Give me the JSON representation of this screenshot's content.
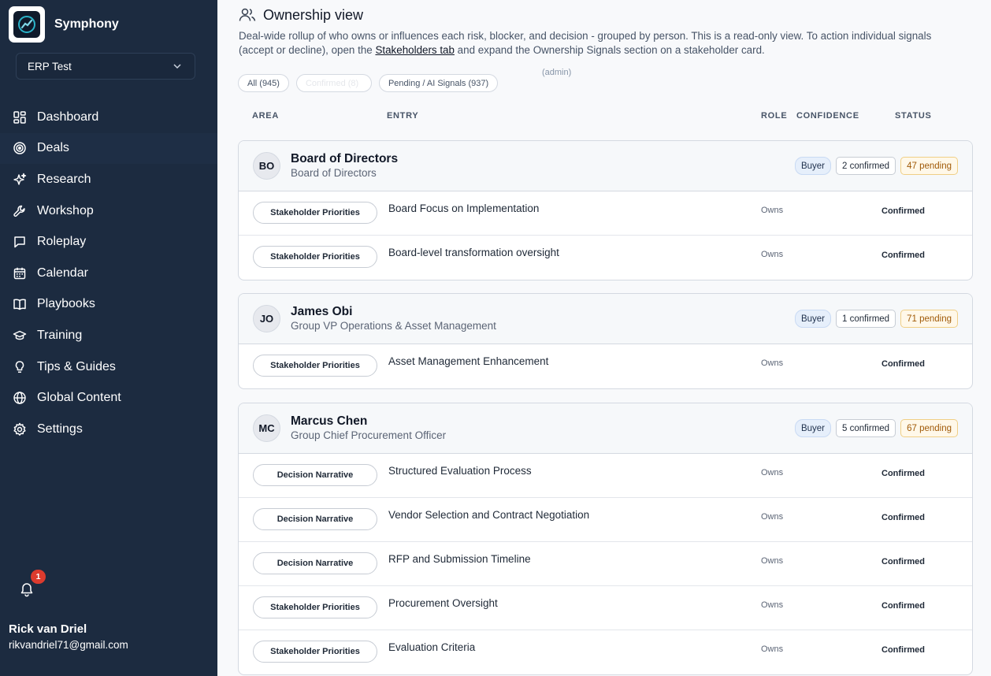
{
  "app": {
    "name": "Symphony"
  },
  "workspace": {
    "name": "ERP Test",
    "role": "(admin)"
  },
  "nav": [
    {
      "label": "Dashboard",
      "icon": "dashboard-icon"
    },
    {
      "label": "Deals",
      "icon": "target-icon"
    },
    {
      "label": "Research",
      "icon": "sparkles-icon"
    },
    {
      "label": "Workshop",
      "icon": "wrench-icon"
    },
    {
      "label": "Roleplay",
      "icon": "chat-icon"
    },
    {
      "label": "Calendar",
      "icon": "calendar-icon"
    },
    {
      "label": "Playbooks",
      "icon": "book-icon"
    },
    {
      "label": "Training",
      "icon": "graduation-cap-icon"
    },
    {
      "label": "Tips & Guides",
      "icon": "lightbulb-icon"
    },
    {
      "label": "Global Content",
      "icon": "globe-icon"
    },
    {
      "label": "Settings",
      "icon": "gear-icon"
    }
  ],
  "notifications": {
    "count": "1"
  },
  "user": {
    "name": "Rick van Driel",
    "email": "rikvandriel71@gmail.com"
  },
  "page": {
    "title": "Ownership view",
    "description_before": "Deal-wide rollup of who owns or influences each risk, blocker, and decision - grouped by person. This is a read-only view. To action individual signals (accept or decline), open the ",
    "description_link": "Stakeholders tab",
    "description_after": " and expand the Ownership Signals section on a stakeholder card."
  },
  "filters": {
    "all": "All (945)",
    "confirmed": "Confirmed (8)",
    "pending": "Pending / AI Signals (937)"
  },
  "columns": {
    "area": "AREA",
    "entry": "ENTRY",
    "role": "ROLE",
    "confidence": "CONFIDENCE",
    "status": "STATUS"
  },
  "groups": [
    {
      "initials": "BO",
      "name": "Board of Directors",
      "title": "Board of Directors",
      "type": "Buyer",
      "confirmed": "2 confirmed",
      "pending": "47 pending",
      "rows": [
        {
          "area": "Stakeholder Priorities",
          "entry": "Board Focus on Implementation",
          "role": "Owns",
          "status": "Confirmed"
        },
        {
          "area": "Stakeholder Priorities",
          "entry": "Board-level transformation oversight",
          "role": "Owns",
          "status": "Confirmed"
        }
      ]
    },
    {
      "initials": "JO",
      "name": "James Obi",
      "title": "Group VP Operations & Asset Management",
      "type": "Buyer",
      "confirmed": "1 confirmed",
      "pending": "71 pending",
      "rows": [
        {
          "area": "Stakeholder Priorities",
          "entry": "Asset Management Enhancement",
          "role": "Owns",
          "status": "Confirmed"
        }
      ]
    },
    {
      "initials": "MC",
      "name": "Marcus Chen",
      "title": "Group Chief Procurement Officer",
      "type": "Buyer",
      "confirmed": "5 confirmed",
      "pending": "67 pending",
      "rows": [
        {
          "area": "Decision Narrative",
          "entry": "Structured Evaluation Process",
          "role": "Owns",
          "status": "Confirmed"
        },
        {
          "area": "Decision Narrative",
          "entry": "Vendor Selection and Contract Negotiation",
          "role": "Owns",
          "status": "Confirmed"
        },
        {
          "area": "Decision Narrative",
          "entry": "RFP and Submission Timeline",
          "role": "Owns",
          "status": "Confirmed"
        },
        {
          "area": "Stakeholder Priorities",
          "entry": "Procurement Oversight",
          "role": "Owns",
          "status": "Confirmed"
        },
        {
          "area": "Stakeholder Priorities",
          "entry": "Evaluation Criteria",
          "role": "Owns",
          "status": "Confirmed"
        }
      ]
    }
  ]
}
